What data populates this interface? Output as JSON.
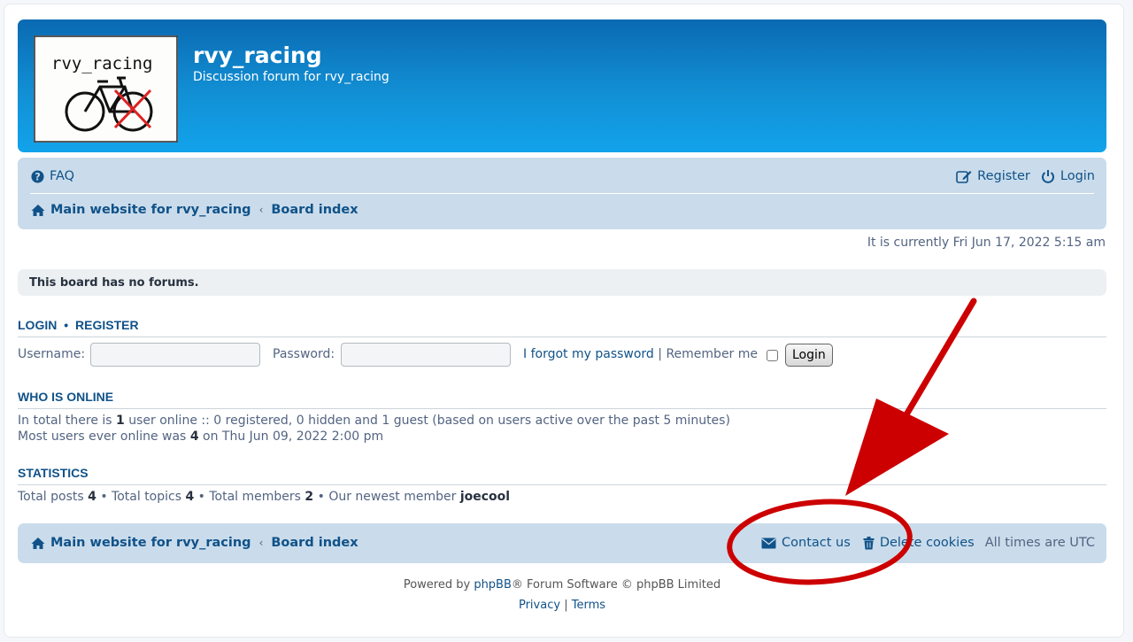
{
  "header": {
    "site_title": "rvy_racing",
    "site_description": "Discussion forum for rvy_racing",
    "logo_text": "rvy_racing"
  },
  "nav": {
    "faq": "FAQ",
    "register": "Register",
    "login": "Login",
    "main_website": "Main website for rvy_racing",
    "board_index": "Board index"
  },
  "datetime": "It is currently Fri Jun 17, 2022 5:15 am",
  "notice": "This board has no forums.",
  "login_section": {
    "title_login": "LOGIN",
    "title_sep": "•",
    "title_register": "REGISTER",
    "username_label": "Username:",
    "username_value": "",
    "password_label": "Password:",
    "password_value": "",
    "forgot": "I forgot my password",
    "pipe": "|",
    "remember": "Remember me",
    "login_button": "Login"
  },
  "who_online": {
    "title": "WHO IS ONLINE",
    "line1_pre": "In total there is ",
    "line1_count": "1",
    "line1_post": " user online :: 0 registered, 0 hidden and 1 guest (based on users active over the past 5 minutes)",
    "line2_pre": "Most users ever online was ",
    "line2_count": "4",
    "line2_post": " on Thu Jun 09, 2022 2:00 pm"
  },
  "statistics": {
    "title": "STATISTICS",
    "posts_label": "Total posts ",
    "posts": "4",
    "topics_label": " • Total topics ",
    "topics": "4",
    "members_label": " • Total members ",
    "members": "2",
    "newest_label": " • Our newest member ",
    "newest": "joecool"
  },
  "footer": {
    "main_website": "Main website for rvy_racing",
    "board_index": "Board index",
    "contact": "Contact us",
    "delete_cookies": "Delete cookies",
    "timezone": "All times are UTC"
  },
  "copyright": {
    "powered_pre": "Powered by ",
    "phpbb": "phpBB",
    "powered_post": "® Forum Software © phpBB Limited",
    "privacy": "Privacy",
    "sep": "|",
    "terms": "Terms"
  },
  "colors": {
    "header_gradient_top": "#0a6ab2",
    "header_gradient_bottom": "#12a3eb",
    "navbar_bg": "#cadceb",
    "link": "#105289",
    "annotation_red": "#cc0000"
  }
}
